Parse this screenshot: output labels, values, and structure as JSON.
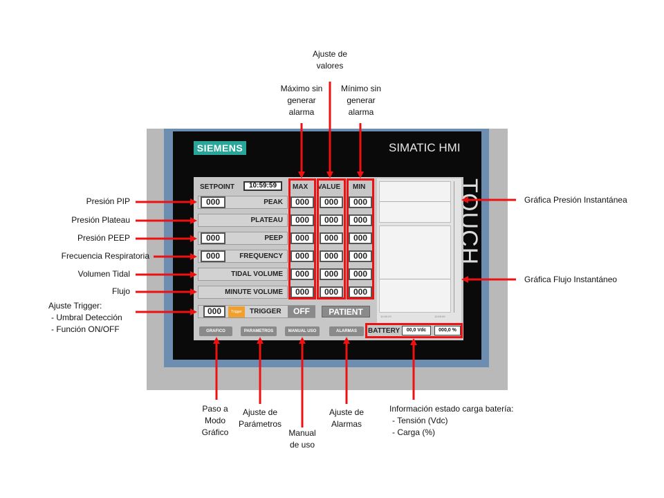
{
  "device": {
    "brand": "SIEMENS",
    "model": "SIMATIC HMI",
    "side_label": "TOUCH"
  },
  "screen": {
    "setpoint_label": "SETPOINT",
    "time": "10:59:59",
    "columns": {
      "max": "MAX",
      "value": "VALUE",
      "min": "MIN"
    },
    "rows": [
      {
        "label": "PEAK",
        "setpoint": "000",
        "max": "000",
        "value": "000",
        "min": "000"
      },
      {
        "label": "PLATEAU",
        "setpoint": "",
        "max": "000",
        "value": "000",
        "min": "000"
      },
      {
        "label": "PEEP",
        "setpoint": "000",
        "max": "000",
        "value": "000",
        "min": "000"
      },
      {
        "label": "FREQUENCY",
        "setpoint": "000",
        "max": "000",
        "value": "000",
        "min": "000"
      },
      {
        "label": "TIDAL VOLUME",
        "setpoint": "",
        "max": "000",
        "value": "000",
        "min": "000"
      },
      {
        "label": "MINUTE VOLUME",
        "setpoint": "",
        "max": "000",
        "value": "000",
        "min": "000"
      }
    ],
    "trigger": {
      "value": "000",
      "icon_text": "Trigger",
      "label": "TRIGGER",
      "toggle": "OFF",
      "patient_button": "PATIENT"
    },
    "nav": [
      "GRAFICO",
      "PARAMETROS",
      "MANUAL USO",
      "ALARMAS"
    ],
    "battery": {
      "label": "BATTERY",
      "voltage": "00,0 Vdc",
      "charge": "000,0 %"
    },
    "graph": {
      "time_start": "10:59:29",
      "time_end": "10:59:59"
    }
  },
  "annotations": {
    "left": [
      "Presión PIP",
      "Presión Plateau",
      "Presión PEEP",
      "Frecuencia Respiratoria",
      "Volumen Tidal",
      "Flujo"
    ],
    "trigger": [
      "Ajuste Trigger:",
      "- Umbral Detección",
      "- Función ON/OFF"
    ],
    "top_adjust": [
      "Ajuste de",
      "valores"
    ],
    "top_max": [
      "Máximo sin",
      "generar",
      "alarma"
    ],
    "top_min": [
      "Mínimo sin",
      "generar",
      "alarma"
    ],
    "right_pressure": "Gráfica Presión Instantánea",
    "right_flow": "Gráfica Flujo Instantáneo",
    "bottom_grafico": [
      "Paso a",
      "Modo",
      "Gráfico"
    ],
    "bottom_param": [
      "Ajuste de",
      "Parámetros"
    ],
    "bottom_manual": [
      "Manual",
      "de uso"
    ],
    "bottom_alarm": [
      "Ajuste de",
      "Alarmas"
    ],
    "bottom_battery": [
      "Información estado carga batería:",
      "- Tensión (Vdc)",
      "- Carga (%)"
    ]
  },
  "colors": {
    "annotation_red": "#ee1111",
    "siemens_teal": "#2aa59a",
    "trigger_orange": "#f0a030"
  }
}
